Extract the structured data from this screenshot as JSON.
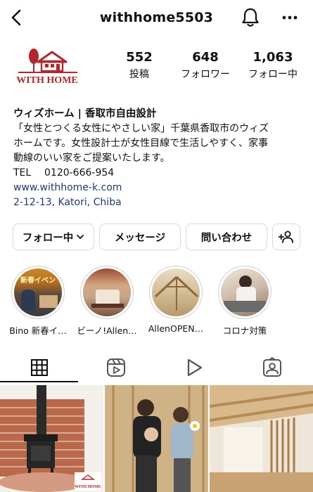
{
  "header": {
    "username": "withhome5503",
    "back_icon": "chevron-left-icon",
    "notification_icon": "bell-icon",
    "more_icon": "more-horizontal-icon"
  },
  "profile": {
    "avatar_logo_text": "WITH HOME",
    "brand_color": "#b3262d",
    "stats": [
      {
        "value": "552",
        "label": "投稿"
      },
      {
        "value": "648",
        "label": "フォロワー"
      },
      {
        "value": "1,063",
        "label": "フォロー中"
      }
    ]
  },
  "bio": {
    "name": "ウィズホーム | 香取市自由設計",
    "lines": [
      "「女性とつくる女性にやさしい家」千葉県香取市のウィズ",
      "ホームです。女性設計士が女性目線で生活しやすく、家事",
      "動線のいい家をご提案いたします。"
    ],
    "tel_label": "TEL",
    "tel_value": "0120-666-954",
    "website": "www.withhome-k.com",
    "address": "2-12-13, Katori, Chiba",
    "link_color": "#1f3b74"
  },
  "buttons": {
    "following": "フォロー中",
    "message": "メッセージ",
    "contact": "問い合わせ",
    "add_user_icon": "add-user-icon"
  },
  "highlights": [
    {
      "label": "Bino 新春イ…",
      "thumb_text": "新春イベン"
    },
    {
      "label": "ビーノ!Allen…"
    },
    {
      "label": "AllenOPEN…"
    },
    {
      "label": "コロナ対策"
    }
  ],
  "tabs": [
    {
      "name": "grid",
      "icon": "grid-icon",
      "active": true
    },
    {
      "name": "reels",
      "icon": "reels-icon",
      "active": false
    },
    {
      "name": "video",
      "icon": "play-icon",
      "active": false
    },
    {
      "name": "tagged",
      "icon": "tagged-person-icon",
      "active": false
    }
  ],
  "grid_posts": [
    {
      "subject": "wood stove on brick hearth",
      "logo_text": "WITH HOME"
    },
    {
      "subject": "people at construction site"
    },
    {
      "subject": "wooden interior with lattice"
    }
  ]
}
